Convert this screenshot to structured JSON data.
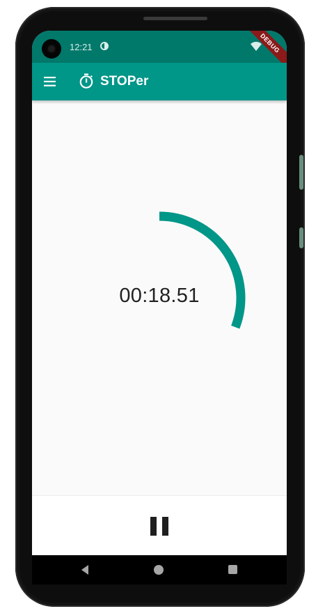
{
  "status_bar": {
    "time": "12:21",
    "debug_banner": "DEBUG"
  },
  "app_bar": {
    "title": "STOPer",
    "menu_icon": "menu-icon",
    "logo_icon": "timer-icon"
  },
  "stopwatch": {
    "elapsed": "00:18.51",
    "seconds_progress": 0.3085,
    "arc_color": "#009688"
  },
  "controls": {
    "pause_icon": "pause-icon"
  },
  "colors": {
    "status_bar": "#00796b",
    "app_bar": "#009688",
    "background": "#fafafa"
  }
}
